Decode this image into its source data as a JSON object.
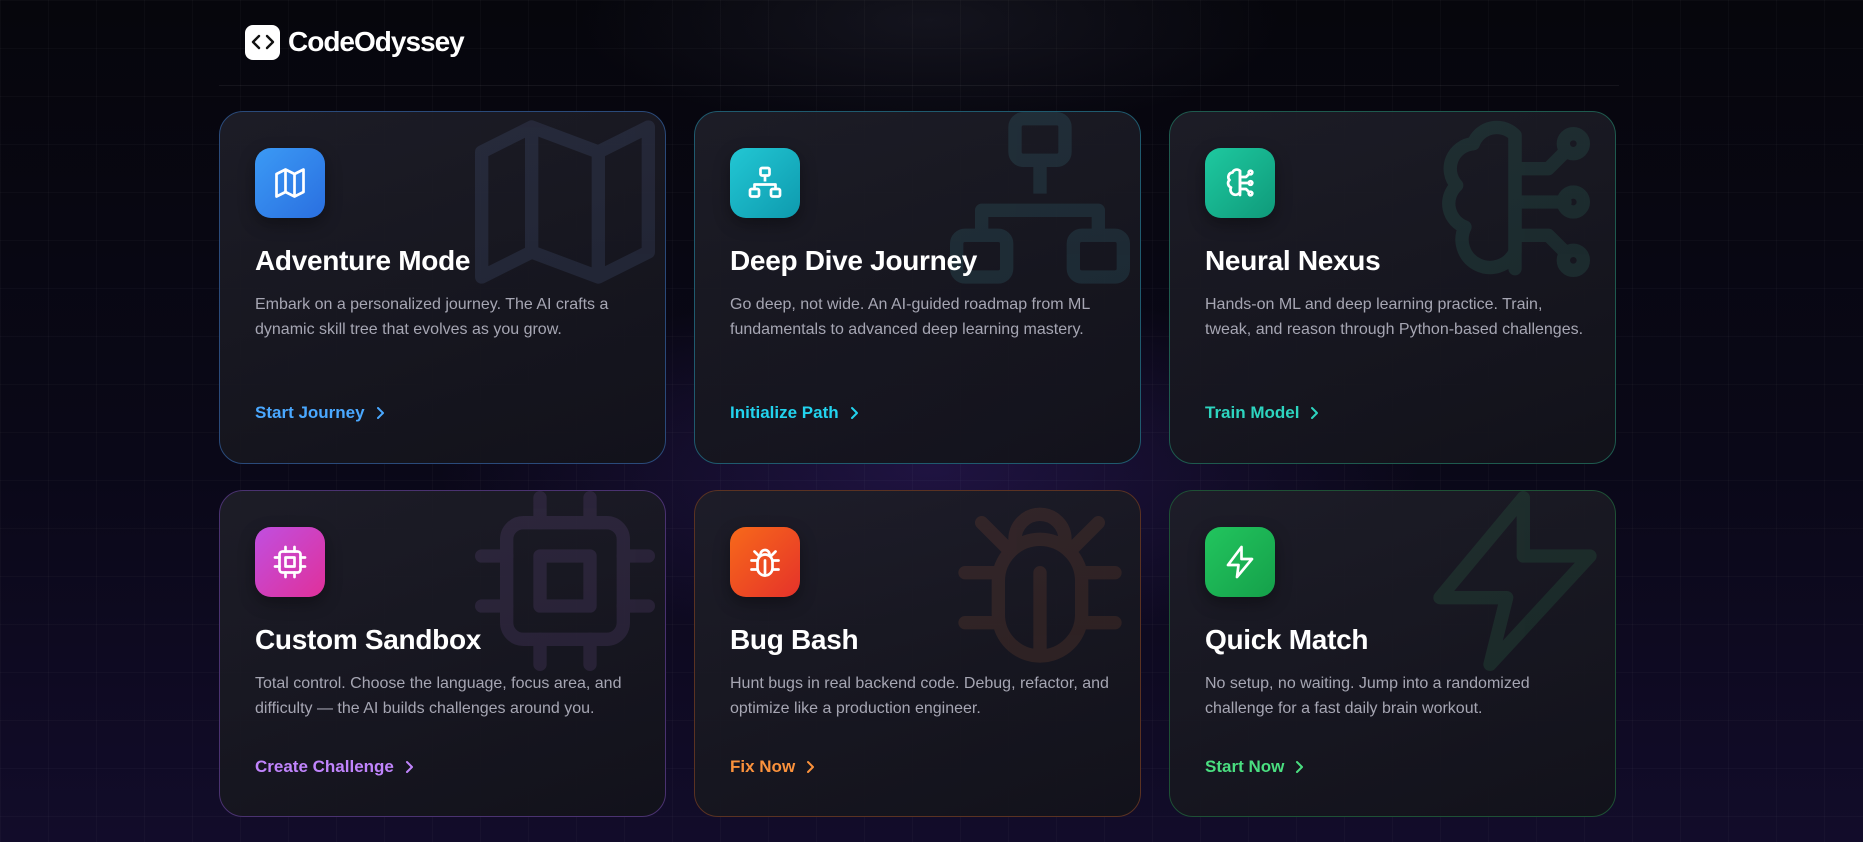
{
  "brand": {
    "name": "CodeOdyssey",
    "logo_icon": "code-brackets-icon"
  },
  "cards": [
    {
      "title": "Adventure Mode",
      "description": "Embark on a personalized journey. The AI crafts a dynamic skill tree that evolves as you grow.",
      "cta": "Start Journey",
      "icon": "map-icon",
      "accent": "#4aa8ff",
      "gradient": [
        "#3b9af5",
        "#2a6fe0"
      ],
      "border": "#2a4a7a"
    },
    {
      "title": "Deep Dive Journey",
      "description": "Go deep, not wide. An AI-guided roadmap from ML fundamentals to advanced deep learning mastery.",
      "cta": "Initialize Path",
      "icon": "network-icon",
      "accent": "#22d3ee",
      "gradient": [
        "#22c7d4",
        "#0e9aae"
      ],
      "border": "#1f5a6e"
    },
    {
      "title": "Neural Nexus",
      "description": "Hands-on ML and deep learning practice. Train, tweak, and reason through Python-based challenges.",
      "cta": "Train Model",
      "icon": "brain-circuit-icon",
      "accent": "#2dd4bf",
      "gradient": [
        "#1ec9a0",
        "#0f9a7a"
      ],
      "border": "#1e5a4e"
    },
    {
      "title": "Custom Sandbox",
      "description": "Total control. Choose the language, focus area, and difficulty — the AI builds challenges around you.",
      "cta": "Create Challenge",
      "icon": "cpu-icon",
      "accent": "#c084fc",
      "gradient": [
        "#c04fe0",
        "#e0309a"
      ],
      "border": "#4a3270"
    },
    {
      "title": "Bug Bash",
      "description": "Hunt bugs in real backend code. Debug, refactor, and optimize like a production engineer.",
      "cta": "Fix Now",
      "icon": "bug-icon",
      "accent": "#fb923c",
      "gradient": [
        "#f7691a",
        "#e5322a"
      ],
      "border": "#5a3222"
    },
    {
      "title": "Quick Match",
      "description": "No setup, no waiting. Jump into a randomized challenge for a fast daily brain workout.",
      "cta": "Start Now",
      "icon": "lightning-icon",
      "accent": "#4ade80",
      "gradient": [
        "#22c55e",
        "#15a04a"
      ],
      "border": "#1e5035"
    }
  ]
}
